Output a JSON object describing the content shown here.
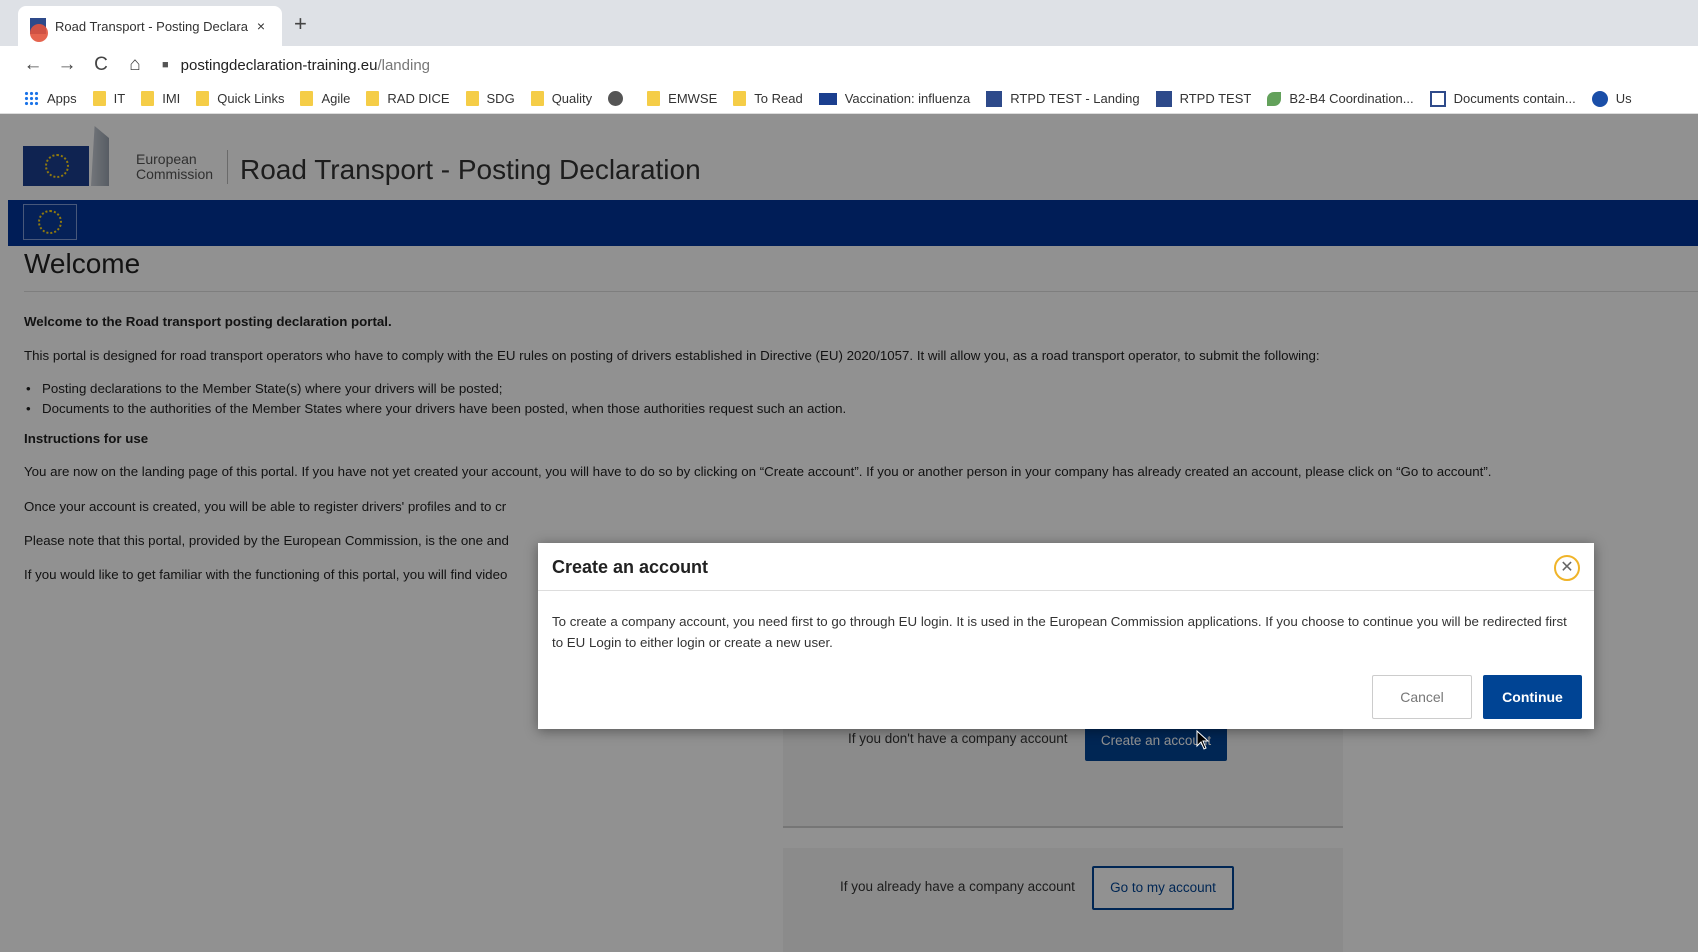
{
  "browser": {
    "tab_title": "Road Transport - Posting Declara",
    "tab_close": "×",
    "new_tab": "+",
    "url_domain": "postingdeclaration-training.eu",
    "url_path": "/landing",
    "nav": {
      "back": "←",
      "forward": "→",
      "reload": "C",
      "home": "⌂"
    },
    "bookmarks": [
      {
        "label": "Apps",
        "icon": "apps-icon"
      },
      {
        "label": "IT",
        "icon": "folder-icon"
      },
      {
        "label": "IMI",
        "icon": "folder-icon"
      },
      {
        "label": "Quick Links",
        "icon": "folder-icon"
      },
      {
        "label": "Agile",
        "icon": "folder-icon"
      },
      {
        "label": "RAD DICE",
        "icon": "folder-icon"
      },
      {
        "label": "SDG",
        "icon": "folder-icon"
      },
      {
        "label": "Quality",
        "icon": "folder-icon"
      },
      {
        "label": "",
        "icon": "globe-icon"
      },
      {
        "label": "EMWSE",
        "icon": "folder-icon"
      },
      {
        "label": "To Read",
        "icon": "folder-icon"
      },
      {
        "label": "Vaccination: influenza",
        "icon": "eu-flag-icon"
      },
      {
        "label": "RTPD TEST - Landing",
        "icon": "ec-logo-icon"
      },
      {
        "label": "RTPD TEST",
        "icon": "ec-logo-icon"
      },
      {
        "label": "B2-B4 Coordination...",
        "icon": "leaf-icon"
      },
      {
        "label": "Documents contain...",
        "icon": "ec-white-icon"
      },
      {
        "label": "Us",
        "icon": "circle-icon"
      }
    ]
  },
  "header": {
    "org_line1": "European",
    "org_line2": "Commission",
    "site_title": "Road Transport - Posting Declaration"
  },
  "main": {
    "heading": "Welcome",
    "intro_bold": "Welcome to the Road transport posting declaration portal.",
    "intro_text": "This portal is designed for road transport operators who have to comply with the EU rules on posting of drivers established in Directive (EU) 2020/1057. It will allow you, as a road transport operator, to submit the following:",
    "bullets": [
      "Posting declarations to the Member State(s) where your drivers will be posted;",
      "Documents to the authorities of the Member States where your drivers have been posted, when those authorities request such an action."
    ],
    "instructions_heading": "Instructions for use",
    "para1": "You are now on the landing page of this portal. If you have not yet created your account, you will have to do so by clicking on “Create account”. If you or another person in your company has already created an account, please click on “Go to account”.",
    "para2": "Once your account is created, you will be able to register drivers' profiles and to cr",
    "para3": "Please note that this portal, provided by the European Commission, is the one and",
    "para4": "If you would like to get familiar with the functioning of this portal, you will find video",
    "no_account_label": "If you don't have a company account",
    "create_account_button": "Create an account",
    "have_account_label": "If you already have a company account",
    "go_account_button": "Go to my account"
  },
  "modal": {
    "title": "Create an account",
    "close_label": "✕",
    "body": "To create a company account, you need first to go through EU login. It is used in the European Commission applications. If you choose to continue you will be redirected first to EU Login to either login or create a new user.",
    "cancel_label": "Cancel",
    "continue_label": "Continue"
  }
}
